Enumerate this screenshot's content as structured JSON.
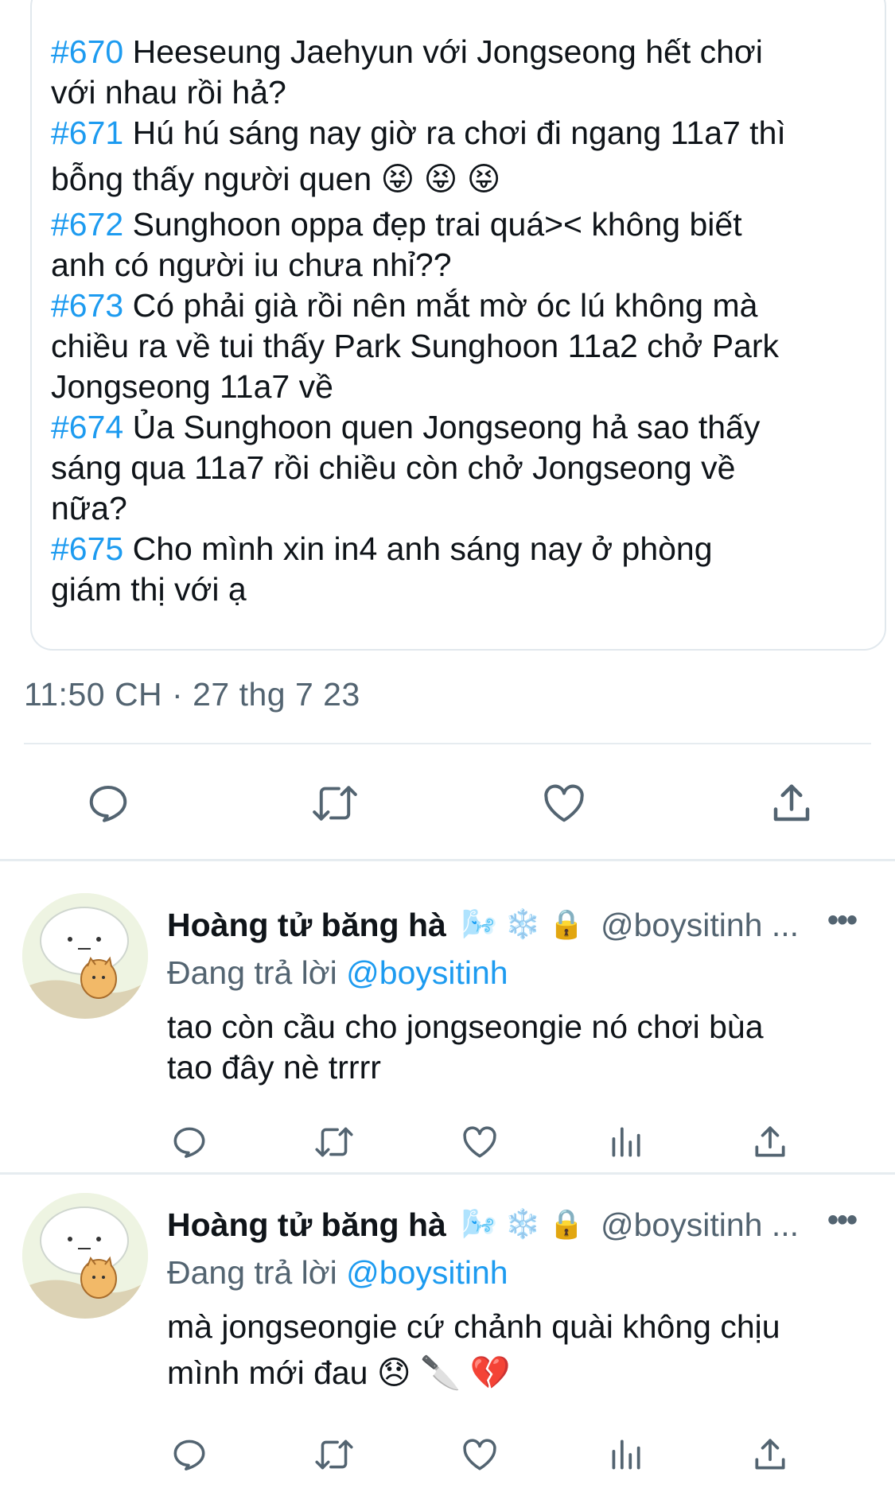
{
  "quote": {
    "lines": [
      {
        "tag": "#670",
        "text": " Heeseung Jaehyun với Jongseong hết chơi"
      },
      {
        "tag": "",
        "text": "với nhau rồi hả?"
      },
      {
        "tag": "#671",
        "text": " Hú hú sáng nay giờ ra chơi đi ngang 11a7 thì"
      },
      {
        "tag": "",
        "text": "bỗng thấy người quen 😝 😝 😝"
      },
      {
        "tag": "#672",
        "text": " Sunghoon oppa đẹp trai quá>< không biết"
      },
      {
        "tag": "",
        "text": "anh có người iu chưa nhỉ??"
      },
      {
        "tag": "#673",
        "text": " Có phải già rồi nên mắt mờ óc lú không mà"
      },
      {
        "tag": "",
        "text": "chiều ra về tui thấy Park Sunghoon 11a2 chở Park"
      },
      {
        "tag": "",
        "text": "Jongseong 11a7 về"
      },
      {
        "tag": "#674",
        "text": " Ủa Sunghoon quen Jongseong hả sao thấy"
      },
      {
        "tag": "",
        "text": "sáng qua 11a7 rồi chiều còn chở Jongseong về"
      },
      {
        "tag": "",
        "text": "nữa?"
      },
      {
        "tag": "#675",
        "text": " Cho mình xin in4 anh sáng nay ở phòng"
      },
      {
        "tag": "",
        "text": "giám thị với ạ"
      }
    ]
  },
  "timestamp": "11:50 CH · 27 thg 7 23",
  "replies": [
    {
      "name": "Hoàng tử băng hà",
      "badges": "🌬️ ❄️ 🔒",
      "handle": "@boysitinh ...",
      "replying_prefix": "Đang trả lời ",
      "replying_mention": "@boysitinh",
      "text_lines": [
        "tao còn cầu cho jongseongie nó chơi bùa",
        "tao đây nè trrrr"
      ]
    },
    {
      "name": "Hoàng tử băng hà",
      "badges": "🌬️ ❄️ 🔒",
      "handle": "@boysitinh ...",
      "replying_prefix": "Đang trả lời ",
      "replying_mention": "@boysitinh",
      "text_lines": [
        "mà jongseongie cứ chảnh quài không chịu",
        "mình mới đau 😞 🔪 💔"
      ]
    }
  ],
  "more_label": "•••",
  "colors": {
    "accent": "#1d9bf0",
    "secondary": "#536471",
    "border": "#e1e8ed"
  }
}
